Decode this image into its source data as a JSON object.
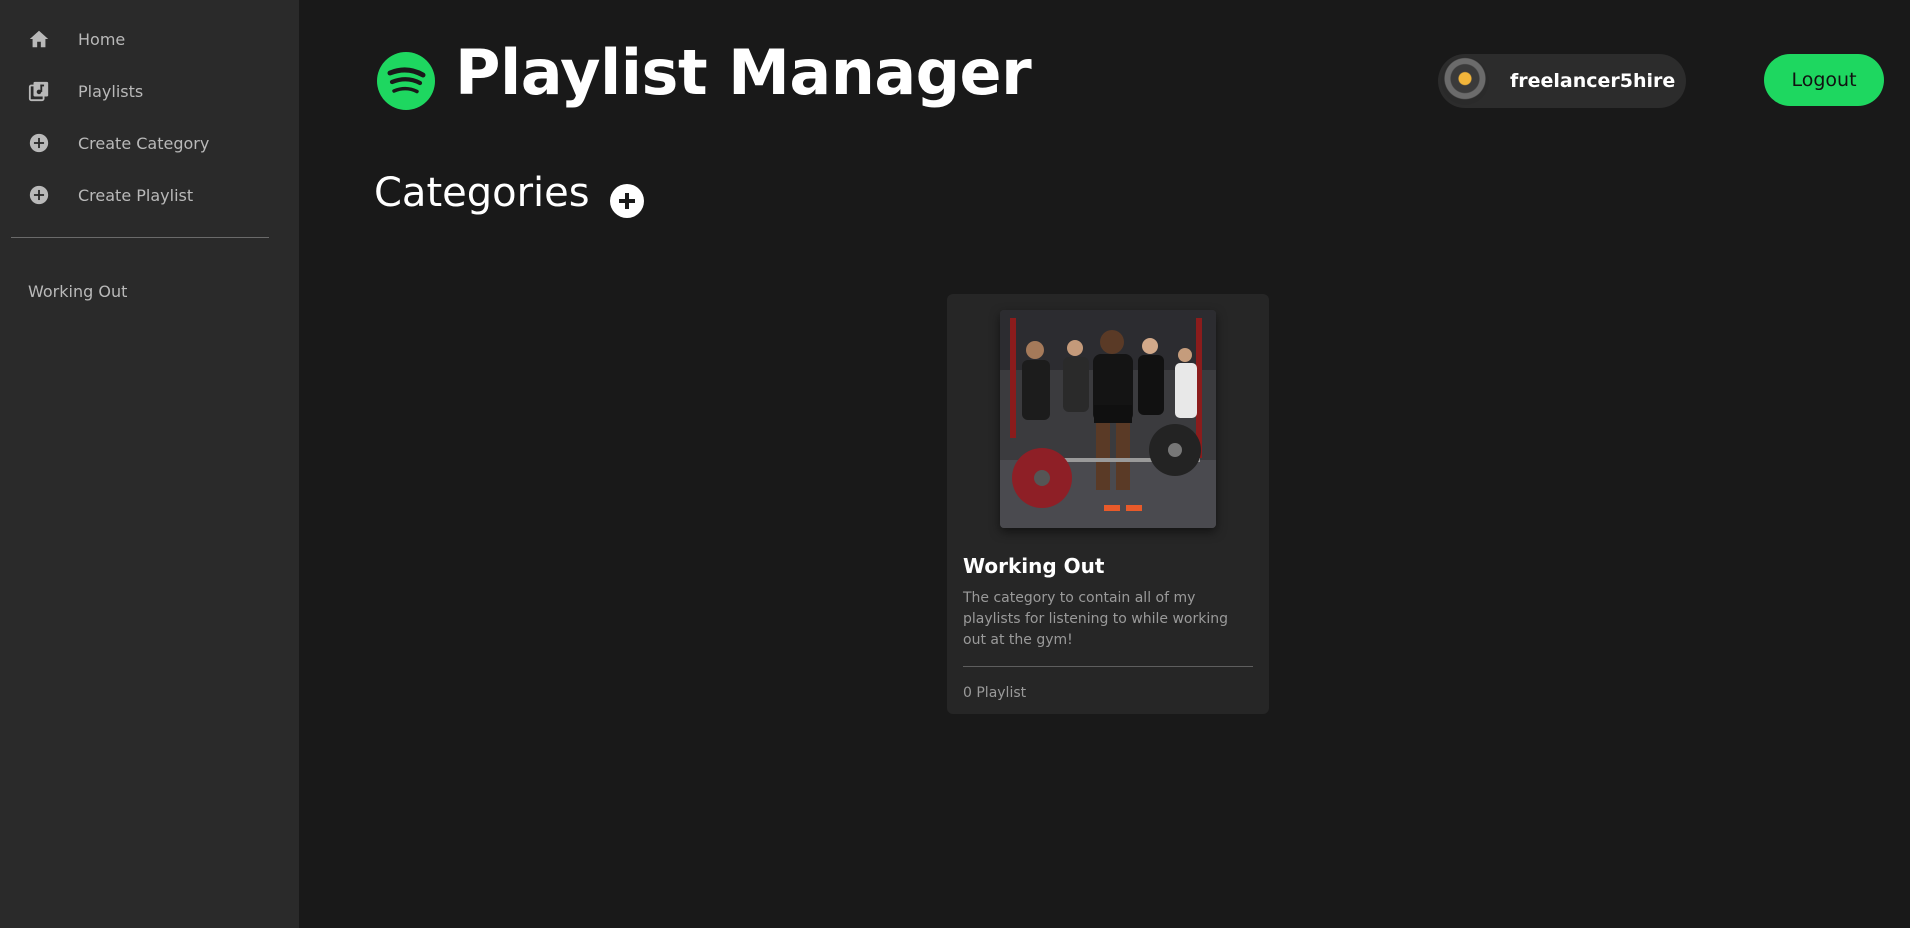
{
  "sidebar": {
    "nav": [
      {
        "label": "Home",
        "icon": "home-icon"
      },
      {
        "label": "Playlists",
        "icon": "playlist-music-icon"
      },
      {
        "label": "Create Category",
        "icon": "plus-circle-icon"
      },
      {
        "label": "Create Playlist",
        "icon": "plus-circle-icon"
      }
    ],
    "categories": [
      "Working Out"
    ]
  },
  "header": {
    "title": "Playlist Manager",
    "logo_icon": "spotify-logo-icon",
    "username": "freelancer5hire",
    "logout_label": "Logout"
  },
  "main": {
    "section_title": "Categories",
    "add_icon": "plus-circle-icon",
    "cards": [
      {
        "title": "Working Out",
        "description": "The category to contain all of my playlists for listening to while working out at the gym!",
        "count": "0 Playlist"
      }
    ]
  },
  "colors": {
    "accent": "#1ed760",
    "background": "#191919",
    "sidebar": "#2a2a2a",
    "card": "#262626"
  }
}
